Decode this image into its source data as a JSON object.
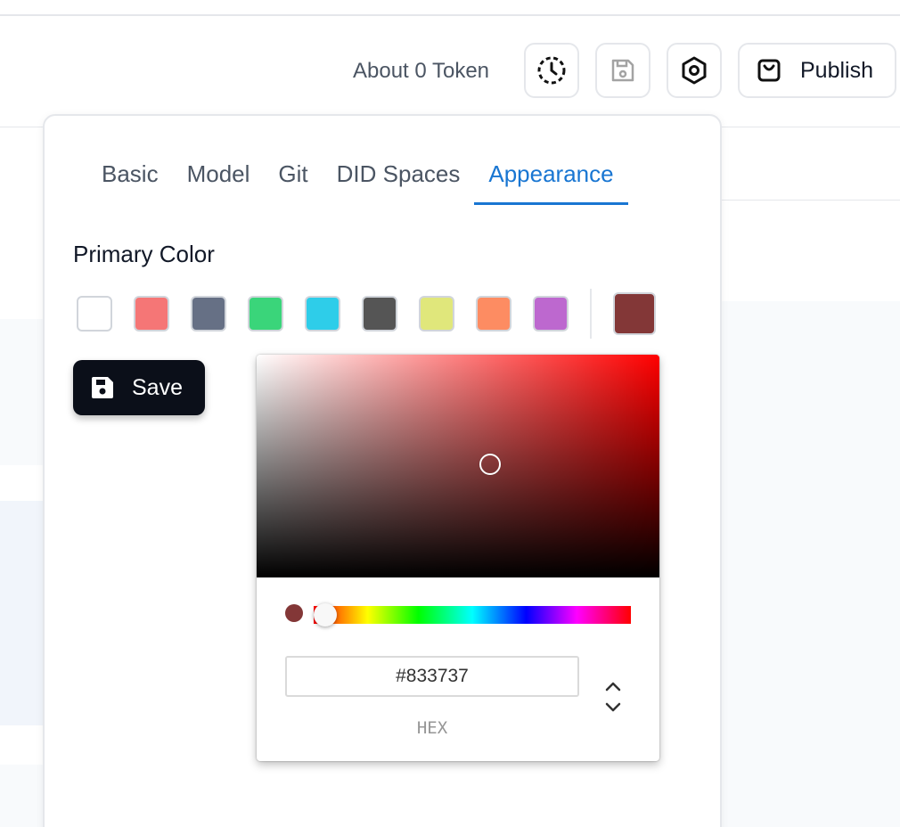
{
  "toolbar": {
    "token_label": "About 0 Token",
    "publish_label": "Publish"
  },
  "settings": {
    "tabs": [
      {
        "label": "Basic",
        "active": false
      },
      {
        "label": "Model",
        "active": false
      },
      {
        "label": "Git",
        "active": false
      },
      {
        "label": "DID Spaces",
        "active": false
      },
      {
        "label": "Appearance",
        "active": true
      }
    ],
    "primary_color_title": "Primary Color",
    "swatches": [
      "#ffffff",
      "#f57676",
      "#667085",
      "#3ad57a",
      "#2ecde9",
      "#555555",
      "#e0e77b",
      "#fd8c62",
      "#bd68cf"
    ],
    "selected_color": "#833737",
    "save_label": "Save"
  },
  "color_picker": {
    "hex_value": "#833737",
    "hex_label": "HEX",
    "hue": 0
  }
}
